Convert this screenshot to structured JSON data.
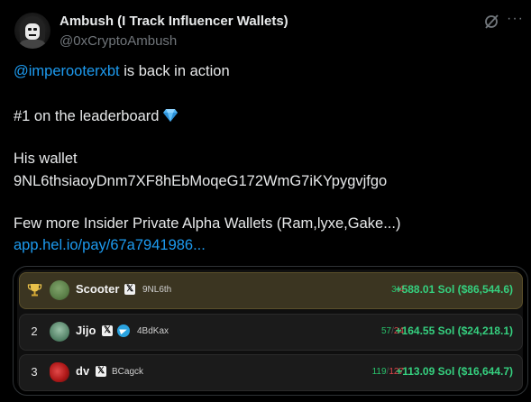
{
  "author": {
    "display_name": "Ambush (I Track Influencer Wallets)",
    "handle": "@0xCryptoAmbush"
  },
  "tweet": {
    "line1_mention": "@imperooterxbt",
    "line1_rest": " is back in action",
    "line2": "#1 on the leaderboard",
    "line3": "His wallet",
    "line4": "9NL6thsiaoyDnm7XF8hEbMoqeG172WmG7iKYpygvjfgo",
    "line5": "Few more Insider Private Alpha Wallets (Ram,lyxe,Gake...)",
    "link": "app.hel.io/pay/67a7941986..."
  },
  "leaderboard": {
    "rows": [
      {
        "rank": "",
        "name": "Scooter",
        "addr": "9NL6th",
        "wins": "3",
        "losses": "4",
        "pnl": "+588.01 Sol ($86,544.6)"
      },
      {
        "rank": "2",
        "name": "Jijo",
        "addr": "4BdKax",
        "wins": "57",
        "losses": "24",
        "pnl": "+164.55 Sol ($24,218.1)"
      },
      {
        "rank": "3",
        "name": "dv",
        "addr": "BCagck",
        "wins": "119",
        "losses": "127",
        "pnl": "+113.09 Sol ($16,644.7)"
      }
    ],
    "separator": "/"
  },
  "colors": {
    "background": "#000000",
    "mention": "#1d9bf0",
    "pnl_green": "#35d07f",
    "gold_row": "#3b3521"
  },
  "icons": [
    "avatar",
    "grok-icon",
    "more-icon",
    "gem-icon",
    "trophy-icon",
    "x-icon",
    "telegram-icon"
  ]
}
